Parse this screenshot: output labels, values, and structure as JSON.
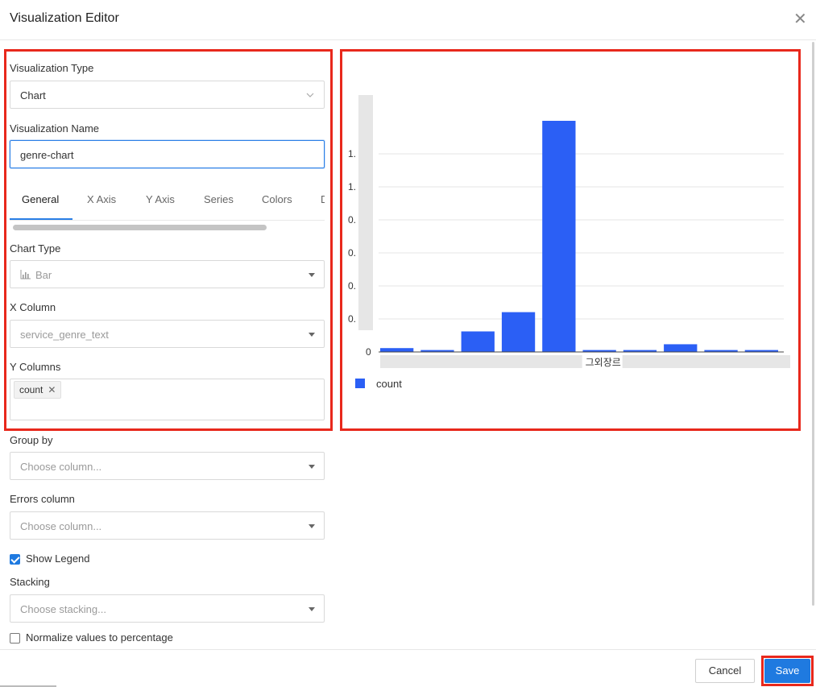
{
  "dialog": {
    "title": "Visualization Editor"
  },
  "form": {
    "viz_type_label": "Visualization Type",
    "viz_type_value": "Chart",
    "viz_name_label": "Visualization Name",
    "viz_name_value": "genre-chart",
    "tabs": [
      "General",
      "X Axis",
      "Y Axis",
      "Series",
      "Colors",
      "D"
    ],
    "active_tab": "General",
    "chart_type_label": "Chart Type",
    "chart_type_value": "Bar",
    "chart_type_icon": "bar-chart-icon",
    "x_column_label": "X Column",
    "x_column_value": "service_genre_text",
    "y_columns_label": "Y Columns",
    "y_columns_values": [
      "count"
    ],
    "group_by_label": "Group by",
    "group_by_placeholder": "Choose column...",
    "errors_label": "Errors column",
    "errors_placeholder": "Choose column...",
    "show_legend_label": "Show Legend",
    "show_legend_checked": true,
    "stacking_label": "Stacking",
    "stacking_placeholder": "Choose stacking...",
    "normalize_label": "Normalize values to percentage",
    "normalize_checked": false
  },
  "chart_data": {
    "type": "bar",
    "categories": [
      "",
      "",
      "",
      "",
      "",
      "그외장르",
      "",
      "",
      "",
      ""
    ],
    "series": [
      {
        "name": "count",
        "color": "#2b5ff5",
        "values": [
          0.06,
          0.03,
          0.32,
          0.62,
          3.6,
          0.03,
          0.03,
          0.12,
          0.03,
          0.03
        ]
      }
    ],
    "y_tick_labels": [
      "0",
      "0.",
      "0.",
      "0.",
      "0.",
      "1.",
      "1."
    ],
    "visible_x_label": "그외장르",
    "ylim": [
      0,
      3.6
    ],
    "grid": true,
    "legend": "bottom-left",
    "legend_entry": "count"
  },
  "footer": {
    "cancel_label": "Cancel",
    "save_label": "Save"
  },
  "colors": {
    "accent": "#1f7ae0",
    "bar": "#2b5ff5",
    "highlight": "#e8281c"
  }
}
